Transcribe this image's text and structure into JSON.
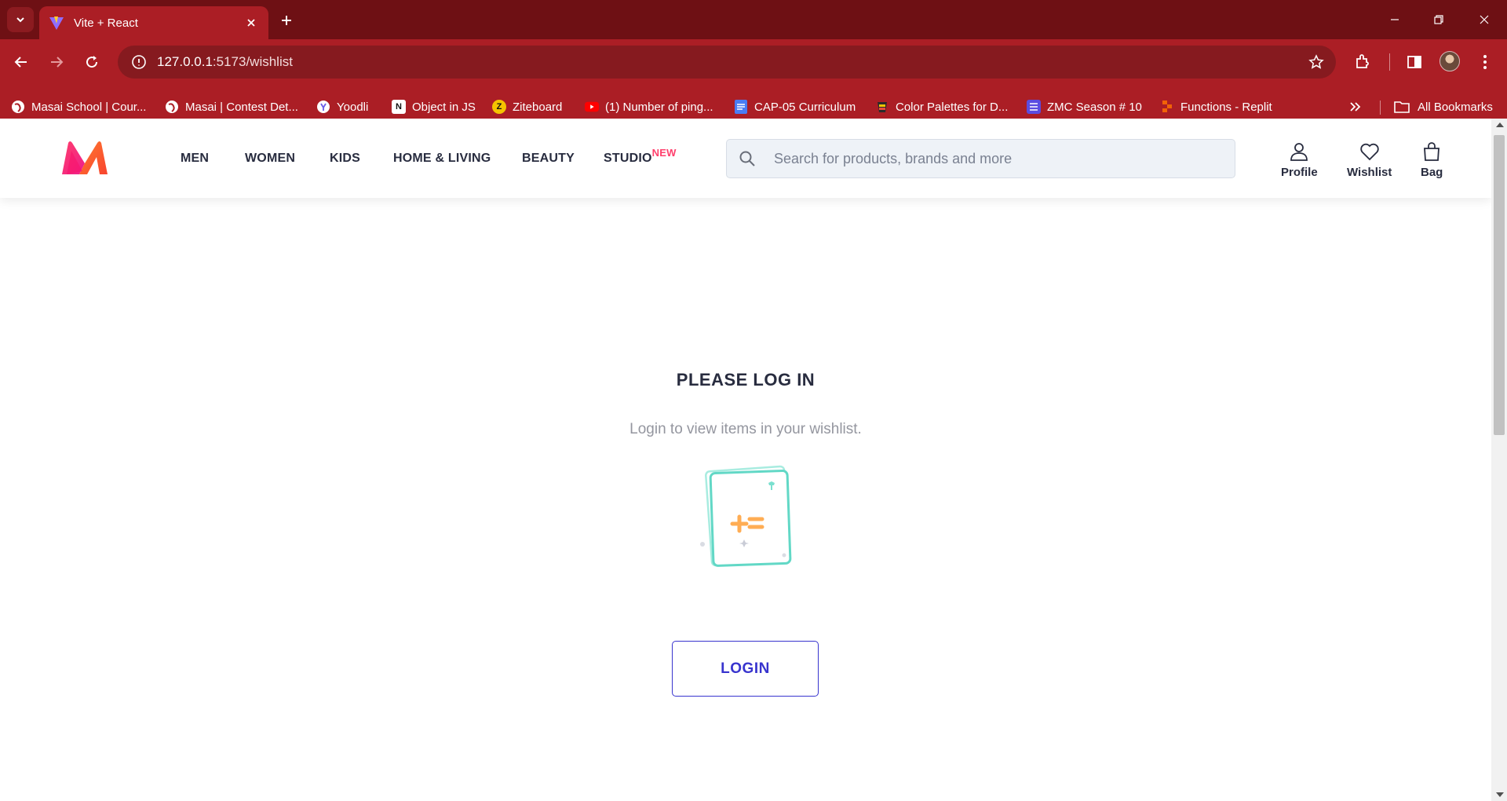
{
  "browser": {
    "tab_title": "Vite + React",
    "url_host": "127.0.0.1",
    "url_rest": ":5173/wishlist",
    "bookmarks": [
      {
        "label": "Masai School | Cour...",
        "icon": "globe-icon"
      },
      {
        "label": "Masai | Contest Det...",
        "icon": "globe-icon"
      },
      {
        "label": "Yoodli",
        "icon": "yoodli-icon"
      },
      {
        "label": "Object in JS",
        "icon": "notion-icon"
      },
      {
        "label": "Ziteboard",
        "icon": "ziteboard-icon"
      },
      {
        "label": "(1) Number of ping...",
        "icon": "youtube-icon"
      },
      {
        "label": "CAP-05 Curriculum",
        "icon": "docs-icon"
      },
      {
        "label": "Color Palettes for D...",
        "icon": "palette-icon"
      },
      {
        "label": "ZMC Season # 10",
        "icon": "list-icon"
      },
      {
        "label": "Functions - Replit",
        "icon": "replit-icon"
      }
    ],
    "all_bookmarks": "All Bookmarks"
  },
  "header": {
    "nav": [
      {
        "label": "MEN"
      },
      {
        "label": "WOMEN"
      },
      {
        "label": "KIDS"
      },
      {
        "label": "HOME & LIVING"
      },
      {
        "label": "BEAUTY"
      },
      {
        "label": "STUDIO",
        "badge": "NEW"
      }
    ],
    "search_placeholder": "Search for products, brands and more",
    "actions": {
      "profile": "Profile",
      "wishlist": "Wishlist",
      "bag": "Bag"
    }
  },
  "main": {
    "title": "PLEASE LOG IN",
    "subtitle": "Login to view items in your wishlist.",
    "login_label": "LOGIN"
  },
  "colors": {
    "chrome_dark": "#6e1014",
    "chrome": "#ab1e25",
    "brand_pink": "#ff3f6c",
    "login_accent": "#3834ce",
    "text_dark": "#282c3f",
    "text_muted": "#94969f"
  }
}
